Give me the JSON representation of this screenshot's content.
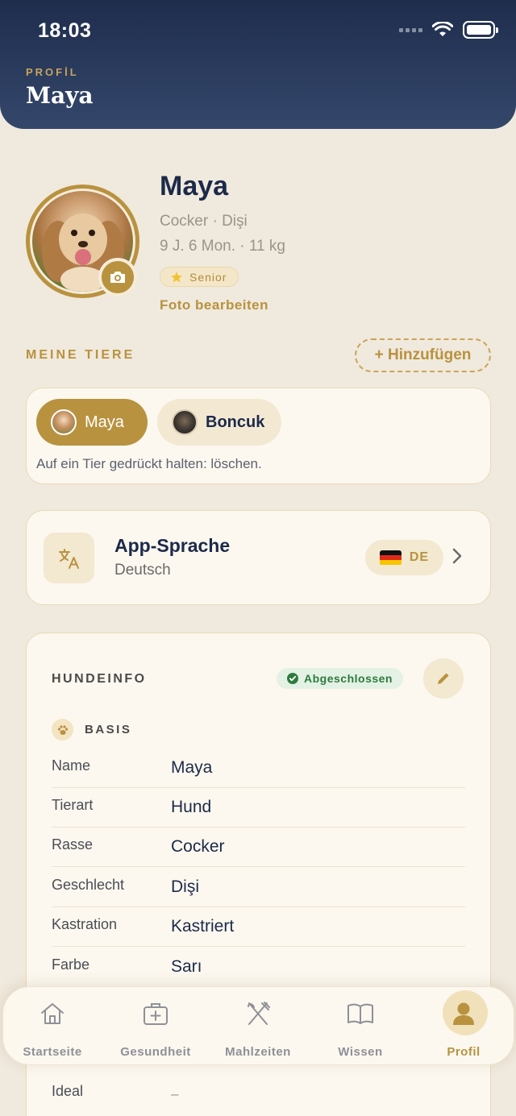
{
  "status": {
    "time": "18:03"
  },
  "header": {
    "kicker": "PROFİL",
    "title": "Maya"
  },
  "pet": {
    "name": "Maya",
    "breed_line": "Cocker · Dişi",
    "age_line": "9 J. 6 Mon. · 11 kg",
    "badge": "Senior",
    "edit_photo": "Foto bearbeiten"
  },
  "my_pets": {
    "label": "MEINE TIERE",
    "add_button": "+ Hinzufügen",
    "pets": [
      {
        "name": "Maya",
        "active": true
      },
      {
        "name": "Boncuk",
        "active": false
      }
    ],
    "hint": "Auf ein Tier gedrückt halten: löschen."
  },
  "language": {
    "title": "App-Sprache",
    "value": "Deutsch",
    "code": "DE"
  },
  "dog_info": {
    "title": "HUNDEINFO",
    "status": "Abgeschlossen",
    "section": "BASIS",
    "rows": [
      {
        "key": "Name",
        "value": "Maya"
      },
      {
        "key": "Tierart",
        "value": "Hund"
      },
      {
        "key": "Rasse",
        "value": "Cocker"
      },
      {
        "key": "Geschlecht",
        "value": "Dişi"
      },
      {
        "key": "Kastration",
        "value": "Kastriert"
      },
      {
        "key": "Farbe",
        "value": "Sarı"
      }
    ],
    "ideal": {
      "key": "Ideal",
      "value": "–"
    }
  },
  "tabbar": {
    "tabs": [
      {
        "label": "Startseite",
        "icon": "home-icon"
      },
      {
        "label": "Gesundheit",
        "icon": "medical-kit-icon"
      },
      {
        "label": "Mahlzeiten",
        "icon": "fork-knife-icon"
      },
      {
        "label": "Wissen",
        "icon": "book-icon"
      },
      {
        "label": "Profil",
        "icon": "user-icon",
        "active": true
      }
    ]
  },
  "colors": {
    "accent": "#b8923f",
    "header_dark": "#1f2d4d",
    "background": "#f0e9dd",
    "success": "#2f7a3e"
  }
}
